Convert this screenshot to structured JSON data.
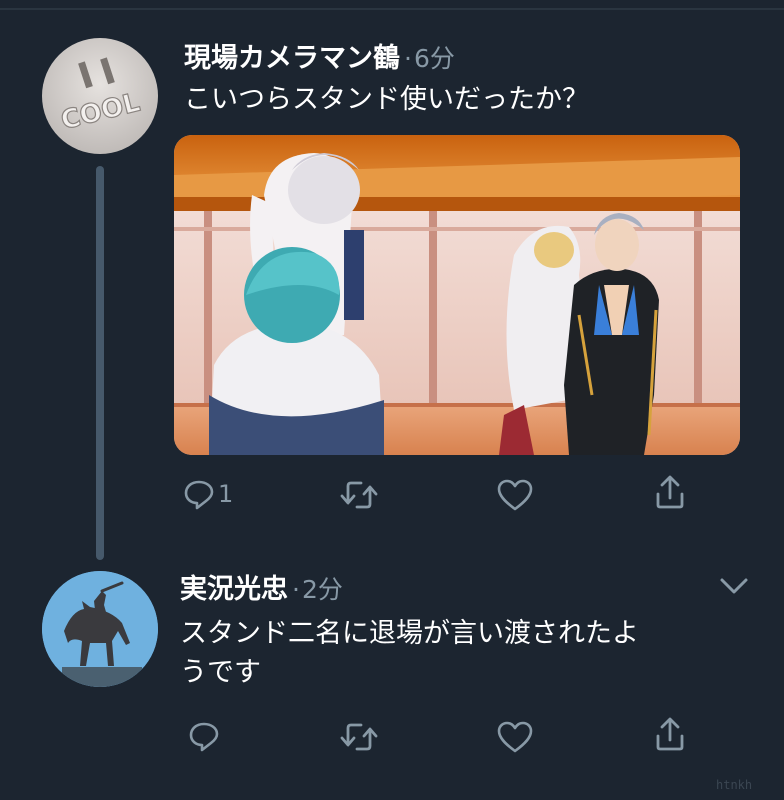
{
  "tweets": [
    {
      "display_name": "現場カメラマン鶴",
      "separator": "·",
      "timestamp": "6分",
      "text": "こいつらスタンド使いだったか？",
      "avatar": {
        "icon": "cool-sign-avatar",
        "text": "COOL"
      },
      "has_media": true,
      "actions": {
        "reply": "1",
        "retweet": "",
        "like": "",
        "share": ""
      }
    },
    {
      "display_name": "実況光忠",
      "separator": "·",
      "timestamp": "2分",
      "text_line1": "スタンド二名に退場が言い渡されたよ",
      "text_line2": "うです",
      "avatar": {
        "icon": "horse-rider-statue-avatar"
      },
      "has_media": false,
      "more_icon": "chevron-down-icon",
      "actions": {
        "reply": "",
        "retweet": "",
        "like": "",
        "share": ""
      }
    }
  ],
  "watermark": "htnkh",
  "colors": {
    "background": "#1c2530",
    "secondary_text": "#8899a6",
    "thread_line": "#46596b",
    "primary_text": "#ffffff"
  }
}
